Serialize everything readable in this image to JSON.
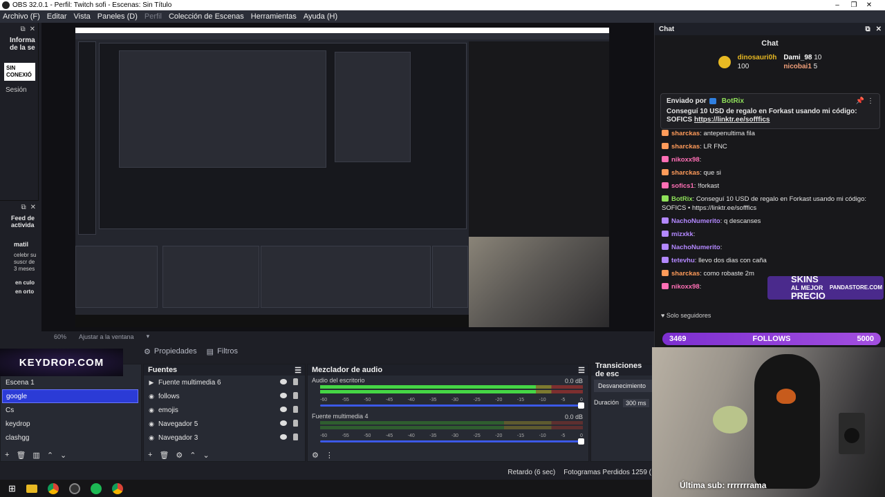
{
  "window": {
    "title": "OBS 32.0.1 - Perfil: Twitch sofi - Escenas: Sin Título",
    "minimize": "–",
    "maximize": "❐",
    "close": "✕"
  },
  "menu": [
    "Archivo (F)",
    "Editar",
    "Vista",
    "Paneles (D)",
    "Perfil",
    "Colección de Escenas",
    "Herramientas",
    "Ayuda (H)"
  ],
  "left_dock": {
    "title": "Informa de la se",
    "status": "SIN CONEXIÓ",
    "session": "Sesión",
    "feed_title": "Feed de activida",
    "feed_user": "matil",
    "feed_text": "celebr su suscr de 3 meses",
    "feed_text2": "en culo en orto"
  },
  "preview": {
    "zoom": "60%",
    "fit": "Ajustar a la ventana"
  },
  "properties": {
    "tab_props": "Propiedades",
    "tab_filters": "Filtros",
    "overlay": "KEYDROP.COM"
  },
  "scenes": {
    "items": [
      "Escena 1",
      "google",
      "Cs",
      "keydrop",
      "clashgg"
    ],
    "selected": 1
  },
  "sources": {
    "title": "Fuentes",
    "items": [
      "Fuente multimedia 6",
      "follows",
      "emojis",
      "Navegador 5",
      "Navegador 3"
    ]
  },
  "mixer": {
    "title": "Mezclador de audio",
    "tracks": [
      {
        "name": "Audio del escritorio",
        "db": "0.0 dB",
        "level": 0.82
      },
      {
        "name": "Fuente multimedia 4",
        "db": "0.0 dB",
        "level": 0.0
      }
    ],
    "scale": [
      "-60",
      "-55",
      "-50",
      "-45",
      "-40",
      "-35",
      "-30",
      "-25",
      "-20",
      "-15",
      "-10",
      "-5",
      "0"
    ]
  },
  "transitions": {
    "title": "Transiciones de esc",
    "type": "Desvanecimiento",
    "duration_label": "Duración",
    "duration_value": "300 ms"
  },
  "status": {
    "delay": "Retardo (6 sec)",
    "dropped": "Fotogramas Perdidos 1259 ("
  },
  "chat": {
    "panel_title": "Chat",
    "title": "Chat",
    "leaders": [
      {
        "name": "dinosauri0h",
        "value": "100",
        "color": "#e8b923"
      },
      {
        "name": "Dami_98",
        "value": "10",
        "color": "#c9c9c9"
      },
      {
        "name": "nicobai1",
        "value": "5",
        "color": "#c9c9c9"
      }
    ],
    "pinned": {
      "label": "Enviado por",
      "user": "BotRix",
      "text": "Conseguí 10 USD de regalo en Forkast usando mi código: SOFICS",
      "link": "https://linktr.ee/sofffics"
    },
    "messages": [
      {
        "user": "sharckas",
        "color": "#ff9b5a",
        "text": ": antepenultima fila"
      },
      {
        "user": "sharckas",
        "color": "#ff9b5a",
        "text": ": LR FNC"
      },
      {
        "user": "nikoxx98",
        "color": "#ff6fb5",
        "text": ":"
      },
      {
        "user": "sharckas",
        "color": "#ff9b5a",
        "text": ": que si"
      },
      {
        "user": "sofics1",
        "color": "#ff6fb5",
        "text": ": !forkast"
      },
      {
        "user": "BotRix",
        "color": "#8fe05a",
        "text": ": Conseguí 10 USD de regalo en Forkast usando mi código: SOFICS • https://linktr.ee/sofffics"
      },
      {
        "user": "NachoNumerito",
        "color": "#b388ff",
        "text": ": q descanses"
      },
      {
        "user": "mizxkk",
        "color": "#b388ff",
        "text": ":"
      },
      {
        "user": "NachoNumerito",
        "color": "#b388ff",
        "text": ":"
      },
      {
        "user": "tetevhu",
        "color": "#b388ff",
        "text": ": llevo dos dias con caña"
      },
      {
        "user": "sharckas",
        "color": "#ff9b5a",
        "text": ": como robaste 2m"
      },
      {
        "user": "nikoxx98",
        "color": "#ff6fb5",
        "text": ":"
      }
    ],
    "followers_only": "Solo seguidores",
    "goal": {
      "current": "3469",
      "label": "FOLLOWS",
      "target": "5000"
    }
  },
  "overlay": {
    "skins_line1": "SKINS",
    "skins_line2": "AL MEJOR",
    "skins_line3": "PRECIO",
    "brand": "PANDASTORE.COM",
    "last_sub": "Última sub: rrrrrrrama"
  }
}
